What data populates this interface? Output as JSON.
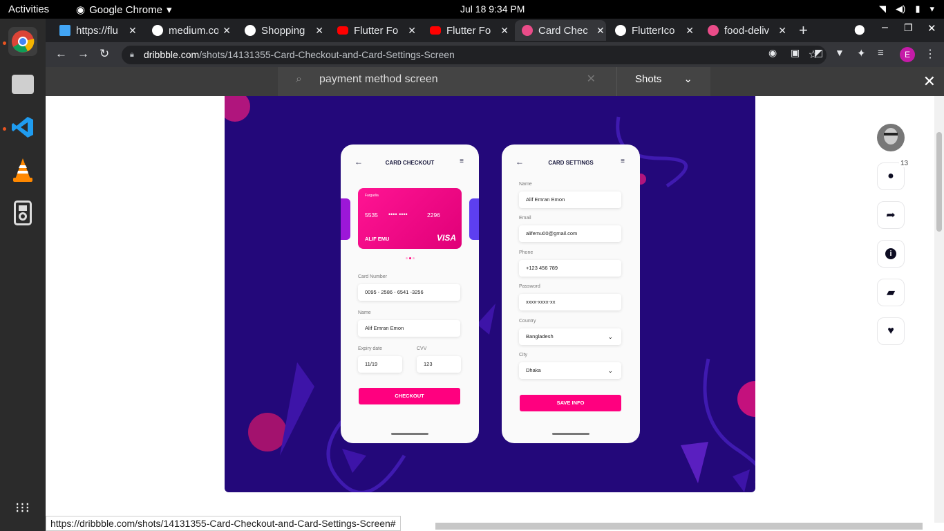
{
  "topbar": {
    "activities": "Activities",
    "app_name": "Google Chrome",
    "datetime": "Jul 18  9:34 PM"
  },
  "tabs": [
    {
      "title": "https://flu",
      "color": "#42a5f5"
    },
    {
      "title": "medium.co",
      "color": "#ffffff"
    },
    {
      "title": "Shopping",
      "color": "#ffffff"
    },
    {
      "title": "Flutter Fo",
      "color": "#ff0000"
    },
    {
      "title": "Flutter Fo",
      "color": "#ff0000"
    },
    {
      "title": "Card Chec",
      "color": "#ea4c89"
    },
    {
      "title": "FlutterIco",
      "color": "#ffffff"
    },
    {
      "title": "food-deliv",
      "color": "#ea4c89"
    }
  ],
  "toolbar": {
    "url_domain": "dribbble.com",
    "url_path": "/shots/14131355-Card-Checkout-and-Card-Settings-Screen",
    "profile_initial": "E"
  },
  "search": {
    "query": "payment method screen",
    "filter": "Shots"
  },
  "checkout": {
    "title": "CARD CHECKOUT",
    "card_bank": "Fargadia",
    "card_digits_first": "5535",
    "card_digits_mask": "•••• ••••",
    "card_digits_last": "2296",
    "card_holder": "ALIF EMU",
    "card_brand": "VISA",
    "card_number_label": "Card Number",
    "card_number_value": "0095 - 2586 - 6541 -3256",
    "name_label": "Name",
    "name_value": "Alif Emran Emon",
    "expiry_label": "Expiry date",
    "expiry_value": "11/19",
    "cvv_label": "CVV",
    "cvv_value": "123",
    "button": "CHECKOUT"
  },
  "settings": {
    "title": "CARD SETTINGS",
    "name_label": "Name",
    "name_value": "Alif Emran Emon",
    "email_label": "Email",
    "email_value": "alifemu00@gmail.com",
    "phone_label": "Phone",
    "phone_value": "+123 456 789",
    "password_label": "Password",
    "password_value": "xxxx-xxxx-xx",
    "country_label": "Country",
    "country_value": "Bangladesh",
    "city_label": "City",
    "city_value": "Dhaka",
    "button": "SAVE INFO"
  },
  "rail": {
    "comment_count": "13"
  },
  "status_url": "https://dribbble.com/shots/14131355-Card-Checkout-and-Card-Settings-Screen#",
  "colors": {
    "accent": "#ff007f",
    "shot_bg": "#23087a"
  }
}
